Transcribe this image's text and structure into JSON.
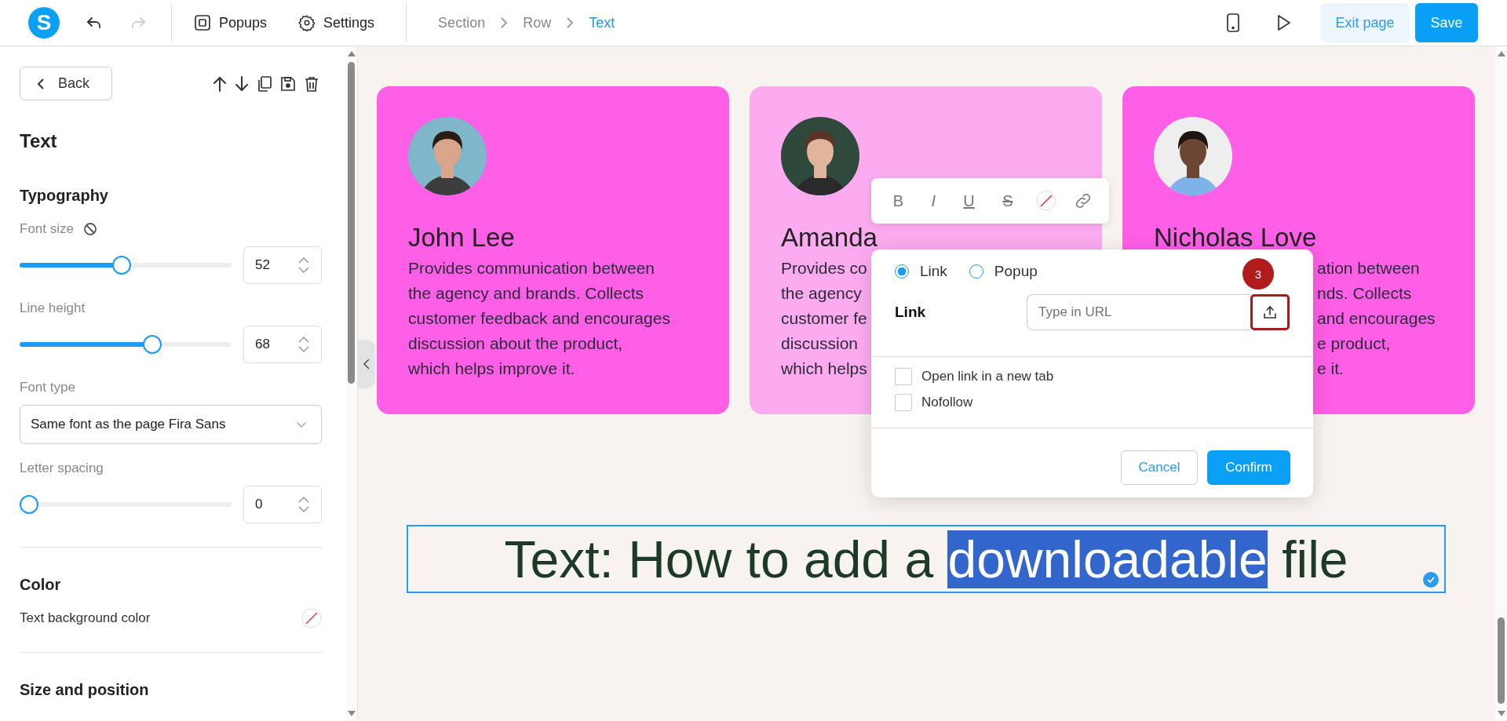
{
  "top_bar": {
    "logo": "S",
    "undo": {
      "disabled": false
    },
    "redo": {
      "disabled": true
    },
    "menu": [
      {
        "kind": "popups",
        "label": "Popups"
      },
      {
        "kind": "settings",
        "label": "Settings"
      }
    ],
    "breadcrumb": [
      {
        "label": "Section",
        "selected": false
      },
      {
        "label": "Row",
        "selected": false
      },
      {
        "label": "Text",
        "selected": true
      }
    ],
    "exit_button": "Exit page",
    "save_button": "Save"
  },
  "sidebar": {
    "back_button": "Back",
    "title": "Text",
    "typography": {
      "heading": "Typography",
      "controls": [
        {
          "kind": "slider",
          "label": "Font size",
          "has_reset": true,
          "level": 0.48,
          "value": "52"
        },
        {
          "kind": "slider",
          "label": "Line height",
          "has_reset": false,
          "level": 0.64,
          "value": "68"
        },
        {
          "kind": "select",
          "label": "Font type",
          "value": "Same font as the page Fira Sans"
        },
        {
          "kind": "slider",
          "label": "Letter spacing",
          "has_reset": false,
          "level": 0,
          "value": "0"
        }
      ]
    },
    "color": {
      "heading": "Color",
      "label": "Text background color"
    },
    "size_heading": "Size and position"
  },
  "cards": [
    {
      "name": "John Lee",
      "clipped_start": false,
      "lines": [
        "Provides communication between",
        "the agency and brands. Collects",
        "customer feedback and encourages",
        "discussion about the product,",
        "which helps improve it."
      ],
      "color": "#ff5ee6"
    },
    {
      "name": "Amanda",
      "clipped_start": false,
      "lines": [
        "Provides co",
        "the agency",
        "customer fe",
        "discussion",
        "which helps"
      ],
      "color": "#fcabf0"
    },
    {
      "name": "Nicholas Love",
      "clipped_start": true,
      "lines": [
        "ation between",
        "nds. Collects",
        "and encourages",
        "e product,",
        "e it."
      ],
      "color": "#ff5ee6"
    }
  ],
  "format_toolbar": [
    {
      "kind": "bold",
      "glyph": "B"
    },
    {
      "kind": "italic",
      "glyph": "I"
    },
    {
      "kind": "underline",
      "glyph": "U"
    },
    {
      "kind": "strike",
      "glyph": "S"
    },
    {
      "kind": "color"
    },
    {
      "kind": "link"
    }
  ],
  "link_dialog": {
    "types": [
      {
        "label": "Link",
        "selected": true
      },
      {
        "label": "Popup",
        "selected": false
      }
    ],
    "field_label": "Link",
    "placeholder": "Type in URL",
    "upload_highlighted": true,
    "step_badge": "3",
    "options": [
      {
        "label": "Open link in a new tab",
        "checked": false
      },
      {
        "label": "Nofollow",
        "checked": false
      }
    ],
    "cancel_button": "Cancel",
    "confirm_button": "Confirm"
  },
  "text_block": {
    "parts": [
      {
        "text": "Text: How to add a ",
        "selected": false
      },
      {
        "text": "downloadable",
        "selected": true
      },
      {
        "text": " file",
        "selected": false
      }
    ]
  }
}
